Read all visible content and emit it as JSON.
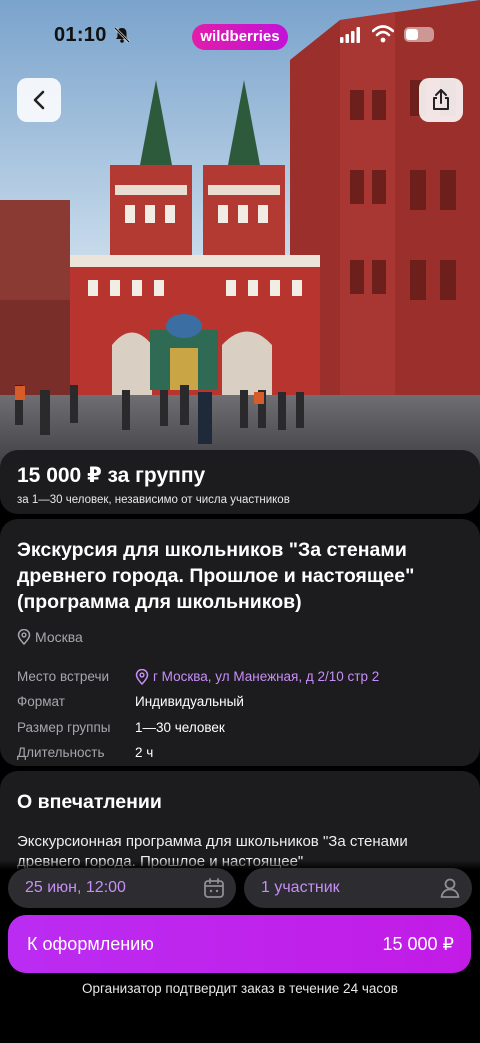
{
  "status_bar": {
    "time": "01:10",
    "brand": "wildberries"
  },
  "price": {
    "amount": "15 000 ₽ за группу",
    "subtitle": "за 1—30 человек, независимо от числа участников"
  },
  "tour": {
    "title": "Экскурсия для школьников \"За стенами древнего города. Прошлое и настоящее\" (программа для школьников)",
    "city": "Москва",
    "details": [
      {
        "label": "Место встречи",
        "value": "г Москва, ул Манежная, д 2/10 стр 2"
      },
      {
        "label": "Формат",
        "value": "Индивидуальный"
      },
      {
        "label": "Размер группы",
        "value": "1—30 человек"
      },
      {
        "label": "Длительность",
        "value": "2 ч"
      }
    ]
  },
  "about": {
    "title": "О впечатлении",
    "text": "Экскурсионная программа для  школьников \"За стенами древнего города. Прошлое и настоящее\""
  },
  "booking": {
    "date": "25 июн, 12:00",
    "participants": "1 участник",
    "cta_label": "К оформлению",
    "cta_price": "15 000 ₽",
    "note": "Организатор подтвердит заказ в течение 24 часов"
  },
  "colors": {
    "accent": "#c21be6",
    "link": "#c78ef7",
    "card": "#1c1c1f",
    "pill": "#2c2c31"
  },
  "icons": [
    "bell-off-icon",
    "signal-icon",
    "wifi-icon",
    "battery-icon",
    "back-arrow-icon",
    "share-icon",
    "location-pin-icon",
    "calendar-icon",
    "person-icon"
  ]
}
